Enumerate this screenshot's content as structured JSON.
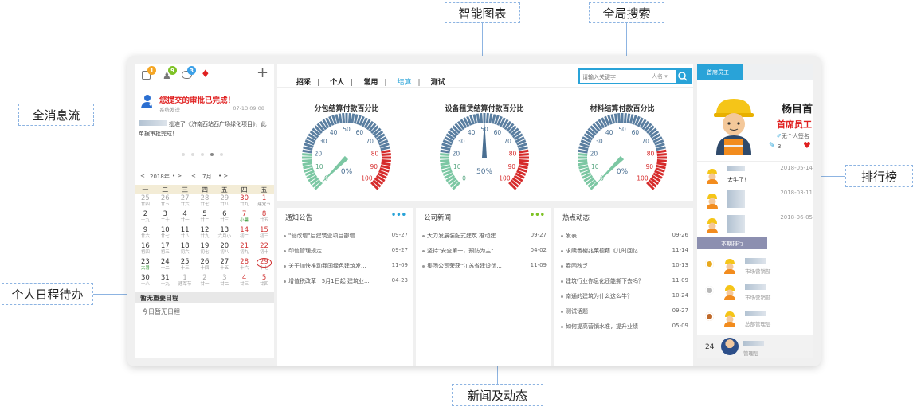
{
  "callouts": {
    "smart_chart": "智能图表",
    "global_search": "全局搜索",
    "message_flow": "全消息流",
    "ranking": "排行榜",
    "schedule": "个人日程待办",
    "news": "新闻及动态"
  },
  "left": {
    "badges": [
      "1",
      "9",
      "3"
    ],
    "message": {
      "title": "您提交的审批已完成！",
      "sender": "系统发送",
      "time": "07-13 09:08",
      "body": "批准了《济南西站西广场绿化项目》，此单据审批完成！"
    },
    "calendar": {
      "year": "2018年",
      "month": "7月",
      "weekdays": [
        "一",
        "二",
        "三",
        "四",
        "五",
        "四",
        "五"
      ],
      "weeks": [
        [
          [
            "25",
            "廿四"
          ],
          [
            "26",
            "廿五"
          ],
          [
            "27",
            "廿六"
          ],
          [
            "28",
            "廿七"
          ],
          [
            "29",
            "廿八"
          ],
          [
            "30",
            "廿九"
          ],
          [
            "1",
            "建党节"
          ]
        ],
        [
          [
            "2",
            "十九"
          ],
          [
            "3",
            "二十"
          ],
          [
            "4",
            "廿一"
          ],
          [
            "5",
            "廿二"
          ],
          [
            "6",
            "廿三"
          ],
          [
            "7",
            "小暑"
          ],
          [
            "8",
            "廿五"
          ]
        ],
        [
          [
            "9",
            "廿六"
          ],
          [
            "10",
            "廿七"
          ],
          [
            "11",
            "廿八"
          ],
          [
            "12",
            "廿九"
          ],
          [
            "13",
            "六月小"
          ],
          [
            "14",
            "初二"
          ],
          [
            "15",
            "初三"
          ]
        ],
        [
          [
            "16",
            "初四"
          ],
          [
            "17",
            "初五"
          ],
          [
            "18",
            "初六"
          ],
          [
            "19",
            "初七"
          ],
          [
            "20",
            "初八"
          ],
          [
            "21",
            "初九"
          ],
          [
            "22",
            "初十"
          ]
        ],
        [
          [
            "23",
            "大暑"
          ],
          [
            "24",
            "十二"
          ],
          [
            "25",
            "十三"
          ],
          [
            "26",
            "十四"
          ],
          [
            "27",
            "十五"
          ],
          [
            "28",
            "十六"
          ],
          [
            "29",
            "十七"
          ]
        ],
        [
          [
            "30",
            "十八"
          ],
          [
            "31",
            "十九"
          ],
          [
            "1",
            "建军节"
          ],
          [
            "2",
            "廿一"
          ],
          [
            "3",
            "廿二"
          ],
          [
            "4",
            "廿三"
          ],
          [
            "5",
            "廿四"
          ]
        ]
      ],
      "today": "29"
    },
    "schedule_header": "暂无重要日程",
    "schedule_empty": "今日暂无日程"
  },
  "tabs": [
    "招采",
    "个人",
    "常用",
    "结算",
    "测试"
  ],
  "active_tab": "结算",
  "search": {
    "placeholder": "请输入关键字",
    "scope": "人名"
  },
  "gauges": [
    {
      "title": "分包结算付款百分比",
      "value": "0%",
      "pct": 0
    },
    {
      "title": "设备租赁结算付款百分比",
      "value": "50%",
      "pct": 50
    },
    {
      "title": "材料结算付款百分比",
      "value": "0%",
      "pct": 0
    }
  ],
  "gauge_ticks": [
    "0",
    "10",
    "20",
    "30",
    "40",
    "50",
    "60",
    "70",
    "80",
    "90",
    "100"
  ],
  "notices": {
    "title": "通知公告",
    "items": [
      {
        "text": "\"营改增\"后建筑业项目部增...",
        "date": "09-27"
      },
      {
        "text": "印信管理规定",
        "date": "09-27"
      },
      {
        "text": "关于加快推动我国绿色建筑发...",
        "date": "11-09"
      },
      {
        "text": "增值税改革 | 5月1日起 建筑业...",
        "date": "04-23"
      }
    ]
  },
  "company_news": {
    "title": "公司新闻",
    "items": [
      {
        "text": "大力发展装配式建筑  推动建...",
        "date": "09-27"
      },
      {
        "text": "坚持\"安全第一，预防为主\"...",
        "date": "04-02"
      },
      {
        "text": "集团公司荣获\"江苏省建设优...",
        "date": "11-09"
      }
    ]
  },
  "hot": {
    "title": "热点动态",
    "items": [
      {
        "text": "发表",
        "date": "09-26"
      },
      {
        "text": "求赎香榭兆莱德藉《儿时回忆...",
        "date": "11-14"
      },
      {
        "text": "春困秋乏",
        "date": "10-13"
      },
      {
        "text": "建筑行业你息化还能撕下去吗？",
        "date": "11-09"
      },
      {
        "text": "南通的建筑为什么这么牛？",
        "date": "10-24"
      },
      {
        "text": "测试话题",
        "date": "09-27"
      },
      {
        "text": "如何提高营销水准，提升业绩",
        "date": "05-09"
      }
    ]
  },
  "right": {
    "tab": "首席员工",
    "name_big": "杨目首",
    "honor": "首席员工",
    "sign": "无个人签名",
    "edits": "3",
    "ranking_items": [
      {
        "date": "2018-05-14",
        "text": "太牛了！"
      },
      {
        "date": "2018-03-11",
        "text": ""
      },
      {
        "date": "2018-06-05",
        "text": ""
      }
    ],
    "period_tab": "本期排行",
    "period": [
      {
        "dept": "市场营销部"
      },
      {
        "dept": "市场营销部"
      },
      {
        "dept": "总部管理层"
      }
    ],
    "me": {
      "rank": "24",
      "dept": "管理层"
    }
  },
  "colors": {
    "accent": "#29a3d8",
    "red": "#e02020",
    "gauge_green": "#7cc7a3",
    "gauge_blue": "#5a7ea0",
    "gauge_red": "#d62b2b"
  }
}
